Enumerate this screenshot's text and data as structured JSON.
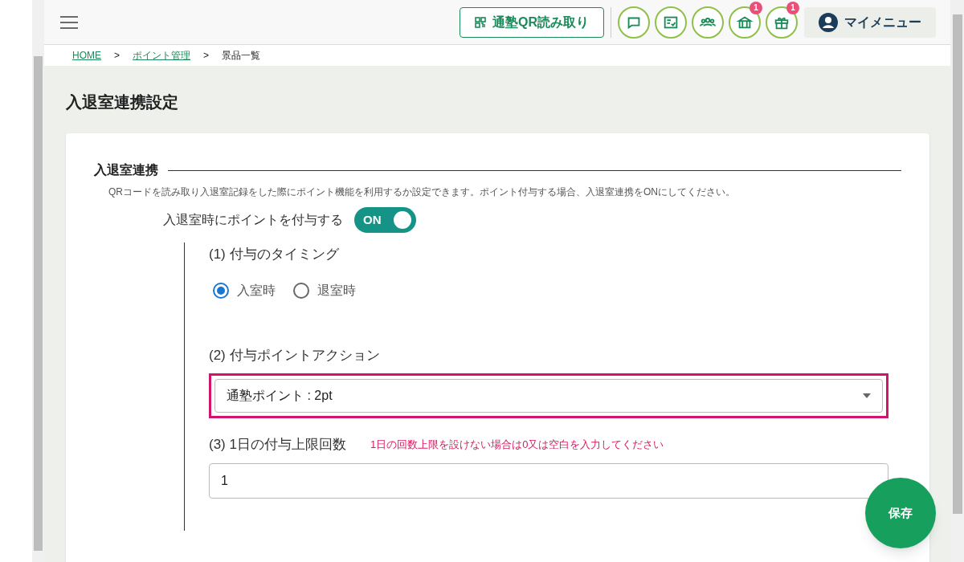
{
  "header": {
    "qr_button": "通塾QR読み取り",
    "icon_buttons": [
      {
        "kind": "chat"
      },
      {
        "kind": "checklist"
      },
      {
        "kind": "group"
      },
      {
        "kind": "shop",
        "badge": "1"
      },
      {
        "kind": "gift",
        "badge": "1"
      }
    ],
    "my_menu": "マイメニュー"
  },
  "breadcrumb": [
    {
      "label": "HOME",
      "link": true
    },
    {
      "label": ">",
      "link": false
    },
    {
      "label": "ポイント管理",
      "link": true
    },
    {
      "label": ">",
      "link": false
    },
    {
      "label": "景品一覧",
      "link": false
    }
  ],
  "page_title": "入退室連携設定",
  "section": {
    "title": "入退室連携",
    "description": "QRコードを読み取り入退室記録をした際にポイント機能を利用するか設定できます。ポイント付与する場合、入退室連携をONにしてください。",
    "toggle": {
      "label": "入退室時にポイントを付与する",
      "text": "ON",
      "on": true
    },
    "timing": {
      "label": "(1) 付与のタイミング",
      "options": [
        {
          "label": "入室時",
          "selected": true
        },
        {
          "label": "退室時",
          "selected": false
        }
      ]
    },
    "action": {
      "label": "(2) 付与ポイントアクション",
      "value": "通塾ポイント : 2pt",
      "highlighted": true
    },
    "limit": {
      "label": "(3) 1日の付与上限回数",
      "hint": "1日の回数上限を設けない場合は0又は空白を入力してください",
      "value": "1"
    }
  },
  "save_button": "保存"
}
